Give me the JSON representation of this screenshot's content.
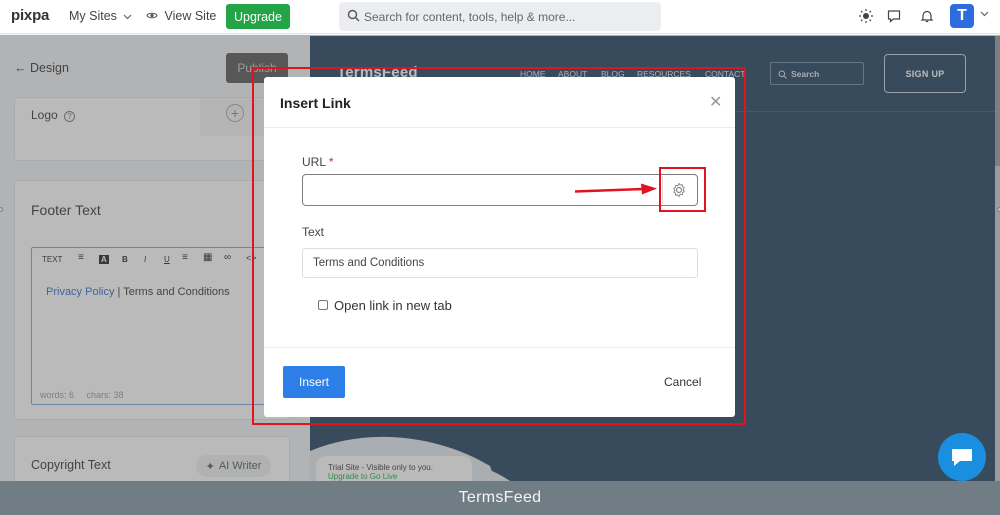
{
  "topbar": {
    "logo": "pixpa",
    "my_sites": "My Sites",
    "view_site": "View Site",
    "upgrade": "Upgrade",
    "search_placeholder": "Search for content, tools, help & more...",
    "avatar_letter": "T"
  },
  "left_panel": {
    "back_label": "Design",
    "publish_label": "Publish",
    "logo_label": "Logo",
    "footer_title": "Footer Text",
    "toolbar_text_label": "TEXT",
    "footer_link_1": "Privacy Policy",
    "footer_sep": "|",
    "footer_link_2": "Terms and Conditions",
    "stats_words": "words: 6",
    "stats_chars": "chars: 38",
    "copyright_title": "Copyright Text",
    "ai_writer": "AI Writer"
  },
  "preview": {
    "brand": "TermsFeed",
    "nav": [
      "HOME",
      "ABOUT",
      "BLOG",
      "RESOURCES",
      "CONTACT"
    ],
    "search": "Search",
    "signup": "SIGN UP",
    "trial_text": "Trial Site - Visible only to you.",
    "trial_link": "Upgrade to Go Live"
  },
  "modal": {
    "title": "Insert Link",
    "url_label": "URL",
    "required_mark": "*",
    "url_value": "",
    "text_label": "Text",
    "text_value": "Terms and Conditions",
    "new_tab_label": "Open link in new tab",
    "new_tab_checked": false,
    "insert_label": "Insert",
    "cancel_label": "Cancel"
  },
  "annotations": {
    "highlight_color": "#e0141e"
  },
  "caption": "TermsFeed"
}
